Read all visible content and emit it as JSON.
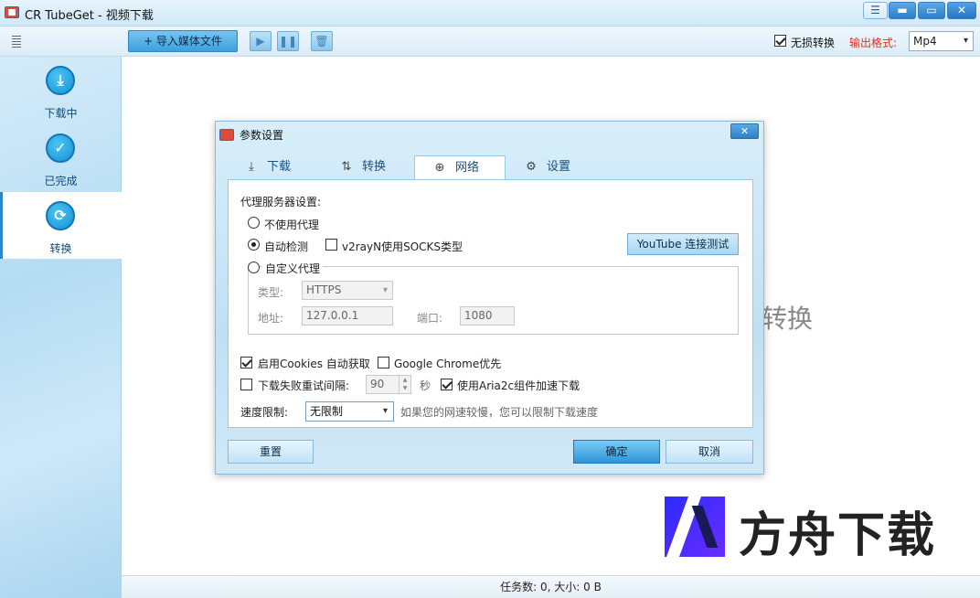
{
  "window": {
    "title": "CR TubeGet - 视频下载",
    "menu_glyph": "☰",
    "min_glyph": "▬",
    "max_glyph": "▭",
    "close_glyph": "✕"
  },
  "toolbar": {
    "import_label": "+ 导入媒体文件",
    "play_glyph": "▶",
    "pause_glyph": "❚❚",
    "trash_glyph": "🗑",
    "lossless_label": "无损转换",
    "lossless_checked": true,
    "format_label": "输出格式:",
    "format_value": "Mp4",
    "dropdown_glyph": "▾"
  },
  "sidebar": {
    "items": [
      {
        "label": "下载中",
        "icon": "download-icon",
        "glyph": "⤓",
        "active": false
      },
      {
        "label": "已完成",
        "icon": "check-icon",
        "glyph": "✓",
        "active": false
      },
      {
        "label": "转换",
        "icon": "convert-icon",
        "glyph": "⟳",
        "active": true
      }
    ]
  },
  "main": {
    "background_text": "转换"
  },
  "status": {
    "text": "任务数: 0, 大小: 0 B"
  },
  "watermark": {
    "text": "方舟下载"
  },
  "dialog": {
    "title": "参数设置",
    "close_glyph": "✕",
    "tabs": [
      {
        "label": "下载",
        "icon": "download-icon",
        "glyph": "⤓"
      },
      {
        "label": "转换",
        "icon": "convert-icon",
        "glyph": "⇅"
      },
      {
        "label": "网络",
        "icon": "globe-icon",
        "glyph": "⊕"
      },
      {
        "label": "设置",
        "icon": "gear-icon",
        "glyph": "⚙"
      }
    ],
    "active_tab": "网络",
    "network": {
      "proxy_heading": "代理服务器设置:",
      "no_proxy_label": "不使用代理",
      "auto_detect_label": "自动检测",
      "v2rayn_label": "v2rayN使用SOCKS类型",
      "youtube_test_label": "YouTube 连接测试",
      "custom_proxy_label": "自定义代理",
      "type_label": "类型:",
      "type_value": "HTTPS",
      "address_label": "地址:",
      "address_value": "127.0.0.1",
      "port_label": "端口:",
      "port_value": "1080",
      "cookies_label": "启用Cookies 自动获取",
      "cookies_checked": true,
      "chrome_label": "Google Chrome优先",
      "chrome_checked": false,
      "retry_label": "下载失败重试间隔:",
      "retry_checked": false,
      "retry_value": "90",
      "retry_unit": "秒",
      "aria2c_label": "使用Aria2c组件加速下载",
      "aria2c_checked": true,
      "speed_label": "速度限制:",
      "speed_value": "无限制",
      "speed_hint": "如果您的网速较慢，您可以限制下载速度",
      "selected_proxy": "自动检测"
    },
    "buttons": {
      "reset": "重置",
      "ok": "确定",
      "cancel": "取消"
    }
  }
}
